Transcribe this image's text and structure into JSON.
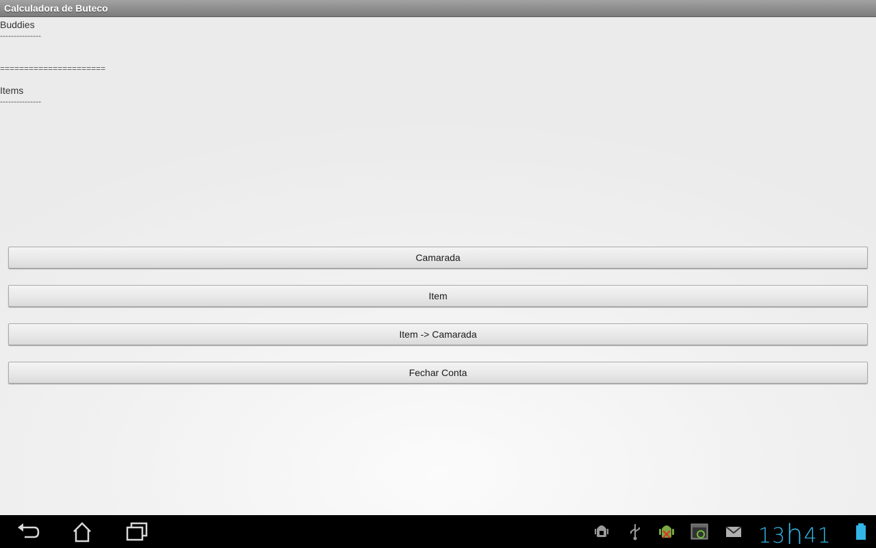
{
  "app": {
    "title": "Calculadora de Buteco"
  },
  "content": {
    "buddies_label": "Buddies",
    "buddies_separator": "---------------",
    "section_separator": "======================",
    "items_label": "Items",
    "items_separator": "---------------"
  },
  "buttons": {
    "camarada": "Camarada",
    "item": "Item",
    "item_to_camarada": "Item -> Camarada",
    "fechar_conta": "Fechar Conta"
  },
  "system_bar": {
    "nav_icons": [
      "back-icon",
      "home-icon",
      "recent-apps-icon"
    ],
    "status_icons": [
      "android-debug-icon",
      "usb-icon",
      "android-error-icon",
      "screenshot-icon",
      "gmail-icon",
      "battery-icon"
    ],
    "clock_hours": "13",
    "clock_sep": "h",
    "clock_minutes": "41",
    "accent_color": "#33b5e5"
  }
}
